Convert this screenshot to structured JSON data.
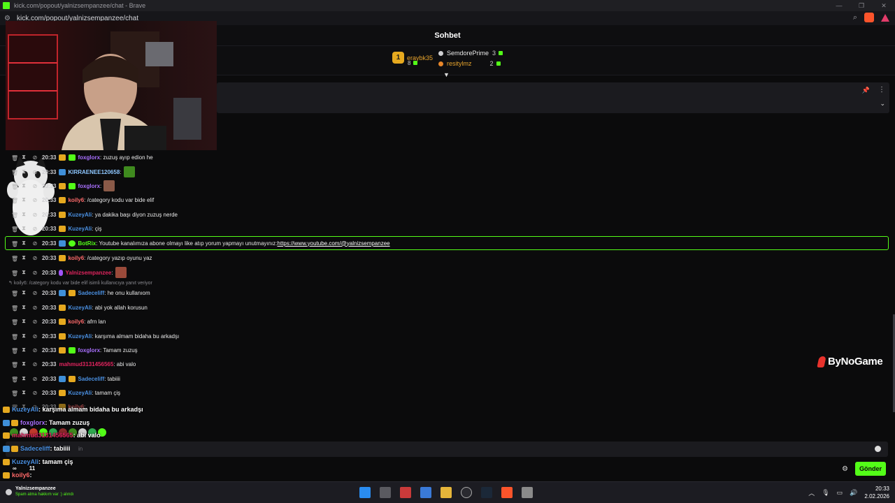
{
  "window": {
    "title": "kick.com/popout/yalnizsempanzee/chat - Brave",
    "url": "kick.com/popout/yalnizsempanzee/chat"
  },
  "header": {
    "title": "Sohbet"
  },
  "leaderboard": {
    "first": {
      "rank": "1",
      "name": "eraybk35",
      "count": "8"
    },
    "second": {
      "name": "SemdorePrime",
      "count": "3"
    },
    "third": {
      "name": "resitylmz",
      "count": "2"
    }
  },
  "messages": [
    {
      "time": "20:33",
      "user": "foxglorx",
      "user_color": "#a970ff",
      "text": ": zuzuş ayıp edion he"
    },
    {
      "time": "20:33",
      "user": "KIRRAENEE120658",
      "user_color": "#8ec7ff",
      "text": ":"
    },
    {
      "time": "20:33",
      "user": "foxglorx",
      "user_color": "#a970ff",
      "text": ":"
    },
    {
      "time": "20:33",
      "user": "koily6",
      "user_color": "#ff6b6b",
      "text": ": /category kodu var bide elif"
    },
    {
      "time": "20:33",
      "user": "KuzeyAli",
      "user_color": "#4a90e2",
      "text": ": ya dakika başı diyon zuzuş nerde"
    },
    {
      "time": "20:33",
      "user": "KuzeyAli",
      "user_color": "#4a90e2",
      "text": ": çiş"
    },
    {
      "time": "20:33",
      "user": "BotRix",
      "user_color": "#53fc18",
      "text": ": Youtube kanalımıza abone olmayı like atıp yorum yapmayı unutmayınız: ",
      "link": "https://www.youtube.com/@yalnizsempanzee"
    },
    {
      "time": "20:33",
      "user": "koily6",
      "user_color": "#ff6b6b",
      "text": ": /category yazıp oyunu yaz"
    },
    {
      "time": "20:33",
      "user": "Yalnizsempanzee",
      "user_color": "#e0245e",
      "text": ":"
    },
    {
      "time": "20:33",
      "user": "Sadeceliff",
      "user_color": "#4a90e2",
      "text": ": he onu kullanıom"
    },
    {
      "time": "20:33",
      "user": "KuzeyAli",
      "user_color": "#4a90e2",
      "text": ": abi yok allah korusun"
    },
    {
      "time": "20:33",
      "user": "koily6",
      "user_color": "#ff6b6b",
      "text": ": afrn lan"
    },
    {
      "time": "20:33",
      "user": "KuzeyAli",
      "user_color": "#4a90e2",
      "text": ": karşıma almam bidaha bu arkadşı"
    },
    {
      "time": "20:33",
      "user": "foxglorx",
      "user_color": "#a970ff",
      "text": ": Tamam zuzuş"
    },
    {
      "time": "20:33",
      "user": "mahmud3131456565",
      "user_color": "#e0245e",
      "text": ": abi valo"
    },
    {
      "time": "20:33",
      "user": "Sadeceliff",
      "user_color": "#4a90e2",
      "text": ": tabiiii"
    },
    {
      "time": "20:33",
      "user": "KuzeyAli",
      "user_color": "#4a90e2",
      "text": ": tamam çiş"
    },
    {
      "time": "20:33",
      "user": "koily6",
      "user_color": "#ff6b6b",
      "text": ":"
    }
  ],
  "reply_context": "koily6: /category kodu var bide elif isimli kullanıcıya yanıt veriyor",
  "overlay": [
    {
      "user": "KuzeyAli",
      "color": "#4a90e2",
      "text": ": karşıma almam bidaha bu arkadşı"
    },
    {
      "user": "foxglorx",
      "color": "#a970ff",
      "text": ": Tamam zuzuş"
    },
    {
      "user": "mahmud3131456565",
      "color": "#e0245e",
      "text": ": abi valo"
    },
    {
      "user": "Sadeceliff",
      "color": "#4a90e2",
      "text": ": tabiiii"
    },
    {
      "user": "KuzeyAli",
      "color": "#4a90e2",
      "text": ": tamam çiş"
    },
    {
      "user": "koily6",
      "color": "#ff6b6b",
      "text": ":"
    }
  ],
  "viewer_stats": {
    "infinity": "∞",
    "count": "11"
  },
  "input": {
    "placeholder": "in"
  },
  "send_label": "Gönder",
  "sponsor": "ByNoGame",
  "notification": {
    "name": "Yalnizsempanzee",
    "text": "Spam atma hakkım var :) alındı"
  },
  "clock": {
    "time": "20:33",
    "date": "2.02.2026"
  },
  "colors": {
    "accent": "#53fc18",
    "gold": "#e6a91f"
  }
}
